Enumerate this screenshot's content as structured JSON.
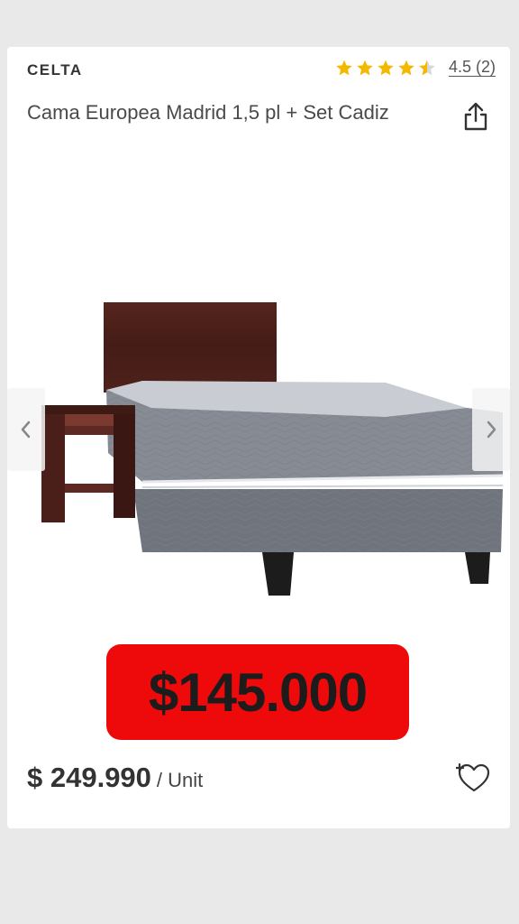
{
  "product": {
    "brand": "CELTA",
    "title": "Cama Europea Madrid 1,5 pl + Set Cadiz",
    "rating": {
      "stars": 4.5,
      "max": 5,
      "label": "4.5 (2)"
    },
    "promo_price": "$145.000",
    "price": "$ 249.990",
    "price_unit": "/ Unit",
    "image": {
      "subject": "bed-with-headboard-and-nightstand"
    }
  },
  "icons": {
    "share": "share-icon",
    "wishlist": "add-to-wishlist-heart-icon",
    "prev": "chevron-left-icon",
    "next": "chevron-right-icon",
    "star": "star-icon"
  },
  "colors": {
    "star": "#f5b800",
    "promo_badge": "#ee0a0a",
    "text": "#333333"
  }
}
